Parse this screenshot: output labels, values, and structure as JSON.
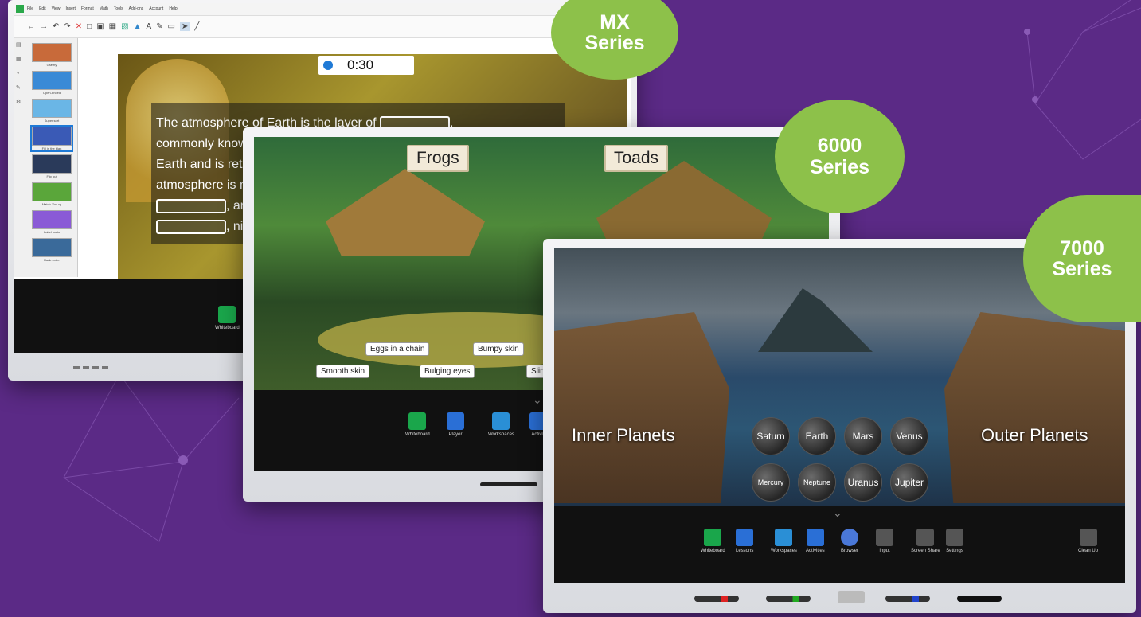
{
  "colors": {
    "background": "#5b2a86",
    "badge": "#8dc14a",
    "bezel": "#e6e7ea",
    "screen_dark": "#111111"
  },
  "badges": [
    {
      "line1": "MX",
      "line2": "Series"
    },
    {
      "line1": "6000",
      "line2": "Series"
    },
    {
      "line1": "7000",
      "line2": "Series"
    }
  ],
  "mx": {
    "menu": [
      "File",
      "Edit",
      "View",
      "Insert",
      "Format",
      "Math",
      "Tools",
      "Add-ons",
      "Account",
      "Help"
    ],
    "pages": [
      "Gravity",
      "Open-ended",
      "Super sort",
      "Fill in the blan",
      "Flip out",
      "Match 'Em up",
      "Label parts",
      "Rank order"
    ],
    "timer": "0:30",
    "text_lines": [
      "The atmosphere of Earth is the layer of",
      "commonly know",
      "Earth and is reta",
      "atmosphere is n",
      ", and",
      ", nitro"
    ],
    "dock": {
      "label": "Whiteboard",
      "icon": "whiteboard-icon"
    }
  },
  "s6000": {
    "signs": [
      "Frogs",
      "Toads"
    ],
    "labels": [
      "Eggs in a chain",
      "Bumpy skin",
      "Smooth skin",
      "Bulging eyes",
      "Slin"
    ],
    "dock": [
      {
        "label": "Whiteboard",
        "icon": "whiteboard-icon",
        "color": "#1aa64b"
      },
      {
        "label": "Player",
        "icon": "lessons-icon",
        "color": "#2a6fd6"
      },
      {
        "label": "Workspaces",
        "icon": "workspaces-icon",
        "color": "#2a8fd6"
      },
      {
        "label": "Activiti",
        "icon": "activities-icon",
        "color": "#2a6fd6"
      }
    ]
  },
  "s7000": {
    "left_group": "Inner Planets",
    "right_group": "Outer Planets",
    "planets_row1": [
      "Saturn",
      "Earth",
      "Mars",
      "Venus"
    ],
    "planets_row2": [
      "Mercury",
      "Neptune",
      "Uranus",
      "Jupiter"
    ],
    "dock": [
      {
        "label": "Whiteboard",
        "icon": "whiteboard-icon",
        "color": "#1aa64b"
      },
      {
        "label": "Lessons",
        "icon": "lessons-icon",
        "color": "#2a6fd6"
      },
      {
        "label": "Workspaces",
        "icon": "workspaces-icon",
        "color": "#2a8fd6"
      },
      {
        "label": "Activities",
        "icon": "activities-icon",
        "color": "#2a6fd6"
      },
      {
        "label": "Browser",
        "icon": "browser-icon",
        "color": "#4a78d8"
      },
      {
        "label": "Input",
        "icon": "input-icon",
        "color": "#555555"
      },
      {
        "label": "Screen Share",
        "icon": "screen-share-icon",
        "color": "#555555"
      },
      {
        "label": "Settings",
        "icon": "gear-icon",
        "color": "#555555"
      }
    ],
    "cleanup": "Clean Up"
  }
}
